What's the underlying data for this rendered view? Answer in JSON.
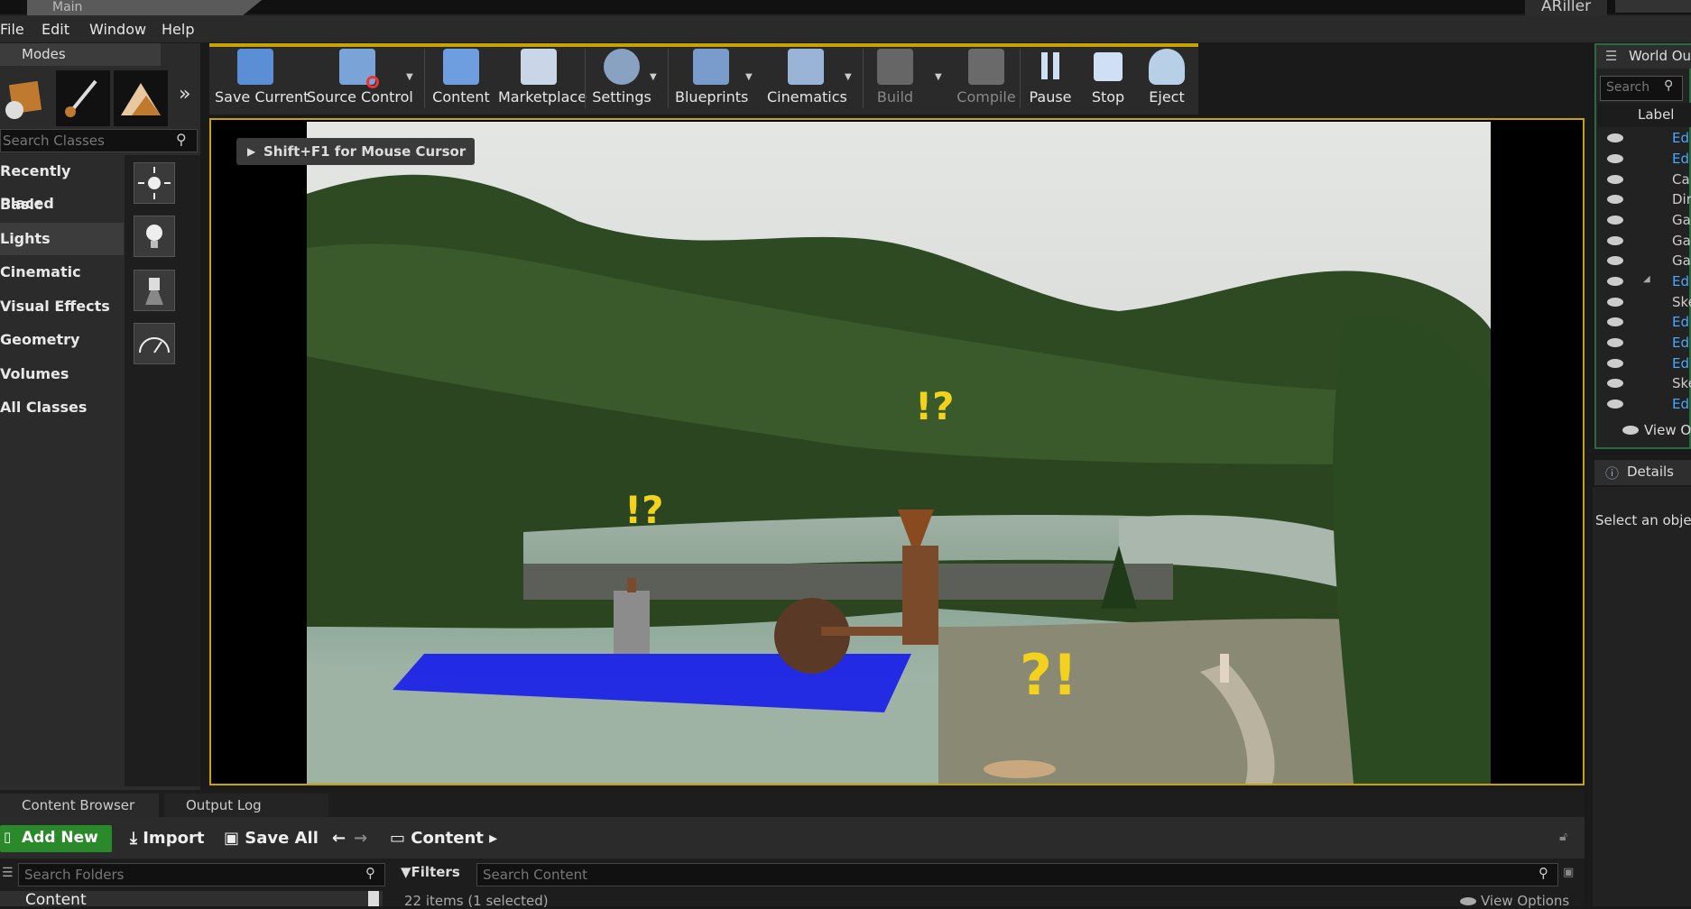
{
  "window": {
    "tab_title": "Main",
    "app_title": "ARiller"
  },
  "menu": [
    "File",
    "Edit",
    "Window",
    "Help"
  ],
  "modes": {
    "tab_label": "Modes",
    "search_placeholder": "Search Classes",
    "categories": [
      "Recently Placed",
      "Basic",
      "Lights",
      "Cinematic",
      "Visual Effects",
      "Geometry",
      "Volumes",
      "All Classes"
    ],
    "selected_category": "Lights"
  },
  "toolbar": {
    "save_current": "Save Current",
    "source_control": "Source Control",
    "content": "Content",
    "marketplace": "Marketplace",
    "settings": "Settings",
    "blueprints": "Blueprints",
    "cinematics": "Cinematics",
    "build": "Build",
    "compile": "Compile",
    "pause": "Pause",
    "stop": "Stop",
    "eject": "Eject"
  },
  "viewport": {
    "hint": "Shift+F1 for Mouse Cursor"
  },
  "outliner": {
    "tab_label": "World Out",
    "search_placeholder": "Search",
    "column_label": "Label",
    "rows": [
      "Ed",
      "Ed",
      "Car",
      "Dire",
      "Gar",
      "Gar",
      "Gar",
      "Ed",
      "Ske",
      "Ed",
      "Ed",
      "Ed",
      "Ske",
      "Ed"
    ],
    "view_options": "View Op"
  },
  "details": {
    "tab_label": "Details",
    "message": "Select an objec"
  },
  "content_browser": {
    "tab_label": "Content Browser",
    "output_tab_label": "Output Log",
    "add_new": "Add New",
    "import": "Import",
    "save_all": "Save All",
    "path": "Content",
    "folder_search_placeholder": "Search Folders",
    "filters": "Filters",
    "content_search_placeholder": "Search Content",
    "root_folder": "Content",
    "item_count": "22 items (1 selected)",
    "view_options": "View Options"
  },
  "colors": {
    "accent": "#c9a400",
    "outliner_border": "#2a6b3d",
    "add_new": "#2a8a2a",
    "link_blue": "#4aa8ff"
  }
}
